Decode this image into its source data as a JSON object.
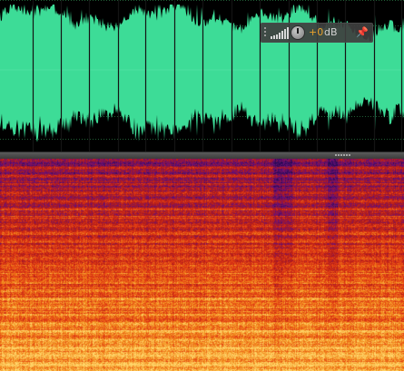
{
  "waveform": {
    "color": "#3ddc97",
    "background": "#000000",
    "grid_color": "#1f5d34",
    "marker_color": "#141414"
  },
  "hud": {
    "gain_value": "+0",
    "gain_unit": "dB",
    "icons": [
      "grip-icon",
      "level-meter-icon",
      "volume-knob-icon",
      "pin-icon"
    ]
  },
  "spectrogram": {
    "palette": [
      "#2a0a55",
      "#6a0f78",
      "#b01a1a",
      "#e23a13",
      "#f28b1c",
      "#ffd66a"
    ]
  }
}
